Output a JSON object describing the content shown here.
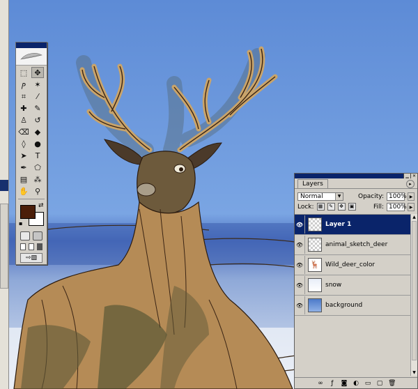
{
  "toolbox": {
    "tools": [
      {
        "name": "marquee-tool-icon",
        "glyph": "⬚"
      },
      {
        "name": "move-tool-icon",
        "glyph": "✥"
      },
      {
        "name": "lasso-tool-icon",
        "glyph": "ⳏ"
      },
      {
        "name": "magic-wand-tool-icon",
        "glyph": "✶"
      },
      {
        "name": "crop-tool-icon",
        "glyph": "⌗"
      },
      {
        "name": "slice-tool-icon",
        "glyph": "⁄"
      },
      {
        "name": "healing-brush-tool-icon",
        "glyph": "✚"
      },
      {
        "name": "brush-tool-icon",
        "glyph": "✎"
      },
      {
        "name": "clone-stamp-tool-icon",
        "glyph": "♙"
      },
      {
        "name": "history-brush-tool-icon",
        "glyph": "↺"
      },
      {
        "name": "eraser-tool-icon",
        "glyph": "⌫"
      },
      {
        "name": "paint-bucket-tool-icon",
        "glyph": "◆"
      },
      {
        "name": "blur-tool-icon",
        "glyph": "◊"
      },
      {
        "name": "dodge-tool-icon",
        "glyph": "●"
      },
      {
        "name": "path-selection-tool-icon",
        "glyph": "➤"
      },
      {
        "name": "type-tool-icon",
        "glyph": "T"
      },
      {
        "name": "pen-tool-icon",
        "glyph": "✒"
      },
      {
        "name": "shape-tool-icon",
        "glyph": "⬠"
      },
      {
        "name": "notes-tool-icon",
        "glyph": "▤"
      },
      {
        "name": "eyedropper-tool-icon",
        "glyph": "⁂"
      },
      {
        "name": "hand-tool-icon",
        "glyph": "✋"
      },
      {
        "name": "zoom-tool-icon",
        "glyph": "⚲"
      }
    ],
    "foreground_color": "#4b1e09",
    "background_color": "#ffffff"
  },
  "layers_panel": {
    "tab_label": "Layers",
    "blend_mode": "Normal",
    "opacity_label": "Opacity:",
    "opacity_value": "100%",
    "lock_label": "Lock:",
    "fill_label": "Fill:",
    "fill_value": "100%",
    "layers": [
      {
        "name": "Layer 1",
        "active": true,
        "thumb": "transparent"
      },
      {
        "name": "animal_sketch_deer",
        "active": false,
        "thumb": "transparent"
      },
      {
        "name": "Wild_deer_color",
        "active": false,
        "thumb": "deer"
      },
      {
        "name": "snow",
        "active": false,
        "thumb": "snow"
      },
      {
        "name": "background",
        "active": false,
        "thumb": "bg"
      }
    ]
  },
  "colors": {
    "sky": "#6f9ad8",
    "selection": "#0a246a",
    "deer_brown": "#5a3b22",
    "deer_tan": "#b58b56"
  }
}
